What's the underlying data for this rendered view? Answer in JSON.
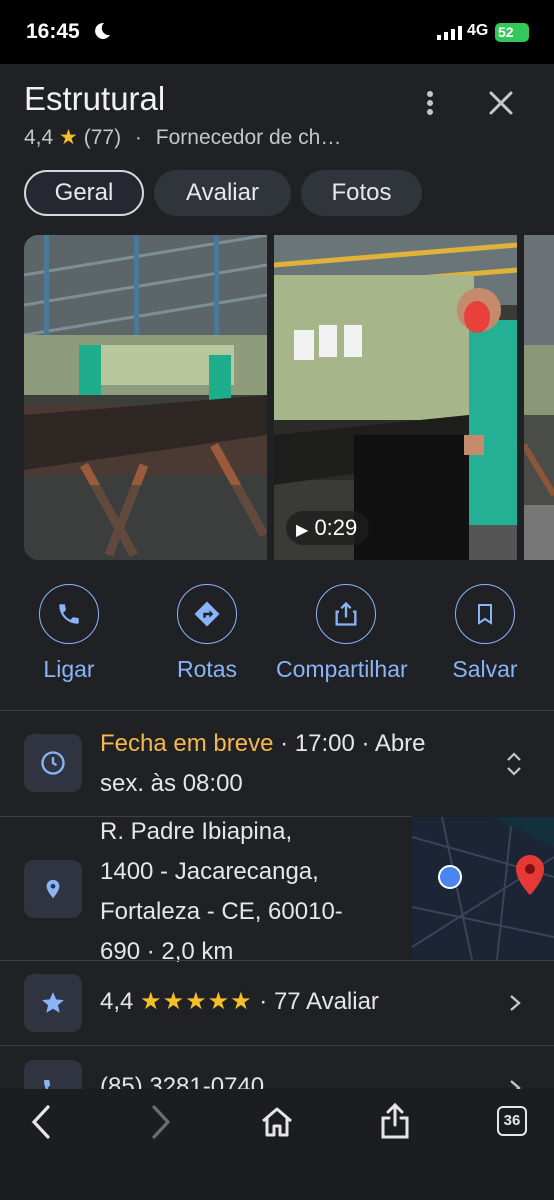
{
  "status_bar": {
    "time": "16:45",
    "network": "4G",
    "battery": "52"
  },
  "place": {
    "title": "Estrutural",
    "rating": "4,4",
    "review_count": "(77)",
    "separator": "·",
    "category": "Fornecedor de ch…"
  },
  "tabs": [
    {
      "label": "Geral",
      "active": true
    },
    {
      "label": "Avaliar",
      "active": false
    },
    {
      "label": "Fotos",
      "active": false
    }
  ],
  "photos": {
    "video_duration": "0:29"
  },
  "actions": [
    {
      "label": "Ligar",
      "icon": "phone-icon"
    },
    {
      "label": "Rotas",
      "icon": "directions-icon"
    },
    {
      "label": "Compartilhar",
      "icon": "share-icon"
    },
    {
      "label": "Salvar",
      "icon": "bookmark-icon"
    }
  ],
  "hours": {
    "status": "Fecha em breve",
    "detail_line1": " · 17:00 · Abre",
    "detail_line2": "sex. às 08:00"
  },
  "address": {
    "line1": "R. Padre Ibiapina,",
    "line2": "1400 - Jacarecanga,",
    "line3": "Fortaleza - CE, 60010-",
    "line4": "690 · 2,0 km"
  },
  "rating_row": {
    "value": "4,4",
    "stars": "★★★★★",
    "text": " · 77 Avaliar"
  },
  "phone": {
    "number": "(85) 3281-0740"
  },
  "bottom_bar": {
    "tab_count": "36"
  },
  "colors": {
    "accent": "#8ab4f8",
    "star": "#f6bf26",
    "warning": "#f6b84a",
    "background": "#1f2125"
  }
}
